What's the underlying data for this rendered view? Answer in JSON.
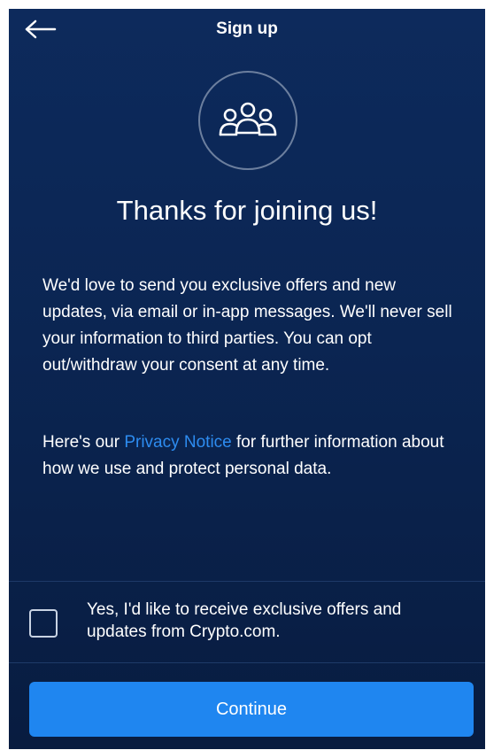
{
  "header": {
    "title": "Sign up",
    "back_icon": "back-arrow-icon"
  },
  "hero": {
    "icon": "group-users-icon",
    "headline": "Thanks for joining us!"
  },
  "body": {
    "paragraph1": "We'd love to send you exclusive offers and new updates, via email or in-app messages. We'll never sell your information to third parties. You can opt out/withdraw your consent at any time.",
    "paragraph2_prefix": "Here's our ",
    "privacy_link": "Privacy Notice",
    "paragraph2_suffix": " for further information about how we use and protect personal data."
  },
  "consent": {
    "checked": false,
    "label": "Yes, I'd like to receive exclusive offers and updates from Crypto.com."
  },
  "actions": {
    "continue_label": "Continue"
  },
  "colors": {
    "background_top": "#0d2a5c",
    "background_bottom": "#081c40",
    "link": "#2d8cf0",
    "primary_button": "#1f86f0"
  }
}
